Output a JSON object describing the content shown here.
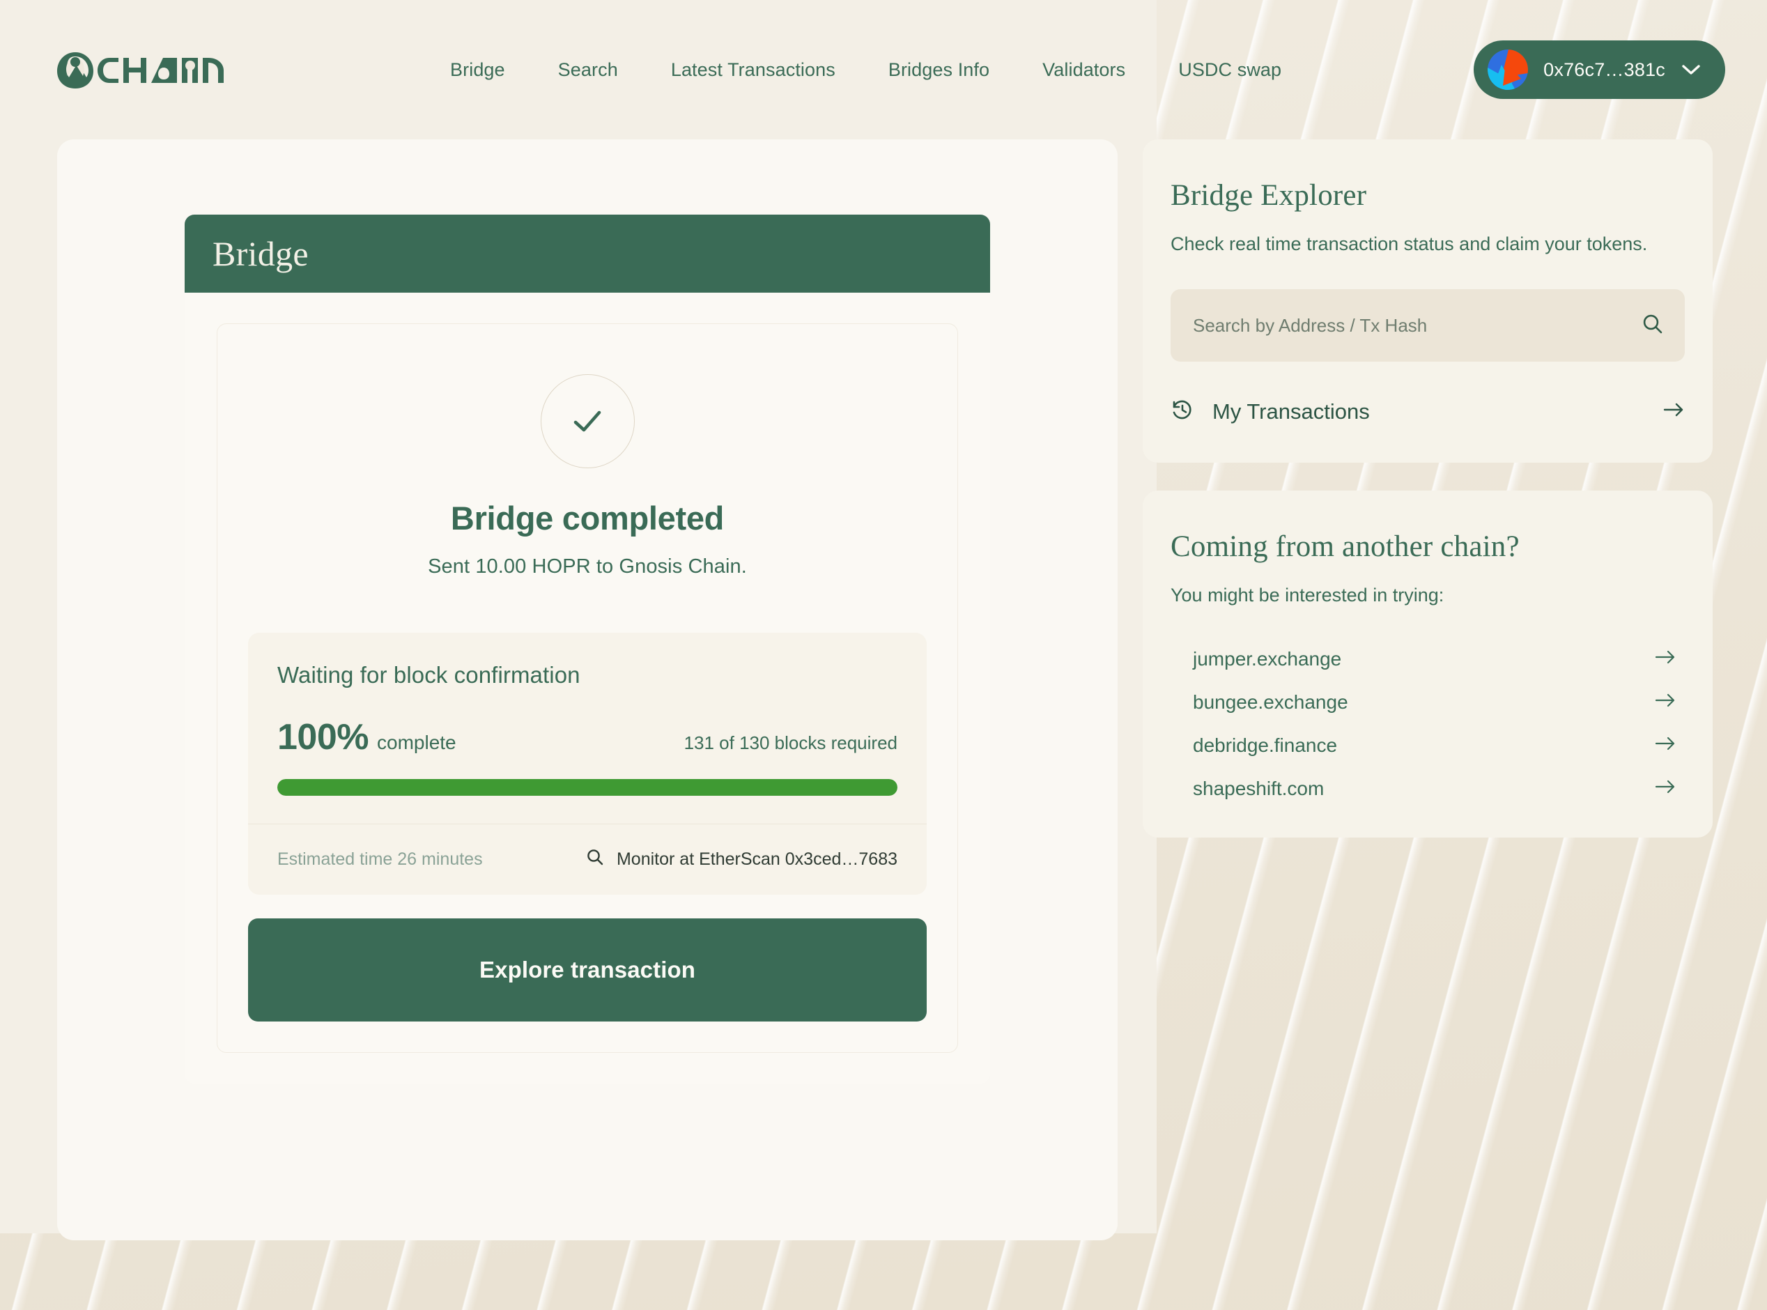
{
  "brand": {
    "logo_text": "CHAIN",
    "logo_icon": "hopr-owl-logo"
  },
  "nav": {
    "links": [
      {
        "label": "Bridge"
      },
      {
        "label": "Search"
      },
      {
        "label": "Latest Transactions"
      },
      {
        "label": "Bridges Info"
      },
      {
        "label": "Validators"
      },
      {
        "label": "USDC swap"
      }
    ],
    "wallet": {
      "address": "0x76c7…381c",
      "avatar_icon": "wallet-avatar",
      "chevron_icon": "chevron-down-icon"
    }
  },
  "bridge": {
    "header_title": "Bridge",
    "status": {
      "check_icon": "check-icon",
      "title": "Bridge completed",
      "subtitle": "Sent 10.00 HOPR to Gnosis Chain."
    },
    "confirmation": {
      "heading": "Waiting for block confirmation",
      "percent_value": "100%",
      "percent_word": "complete",
      "blocks_text": "131 of 130 blocks required",
      "progress_percent": 100,
      "progress_color": "#3f9a33",
      "estimated_time": "Estimated time 26 minutes",
      "monitor_label": "Monitor at EtherScan 0x3ced…7683",
      "monitor_icon": "search-icon"
    },
    "explore_button": "Explore transaction"
  },
  "explorer": {
    "title": "Bridge Explorer",
    "subtitle": "Check real time transaction status and claim your tokens.",
    "search": {
      "placeholder": "Search by Address / Tx Hash",
      "value": "",
      "icon": "search-icon"
    },
    "my_transactions": {
      "label": "My Transactions",
      "leading_icon": "history-icon",
      "trailing_icon": "arrow-right-icon"
    }
  },
  "other_chain": {
    "title": "Coming from another chain?",
    "subtitle": "You might be interested in trying:",
    "links": [
      {
        "label": "jumper.exchange",
        "icon": "arrow-right-icon"
      },
      {
        "label": "bungee.exchange",
        "icon": "arrow-right-icon"
      },
      {
        "label": "debridge.finance",
        "icon": "arrow-right-icon"
      },
      {
        "label": "shapeshift.com",
        "icon": "arrow-right-icon"
      }
    ]
  },
  "colors": {
    "brand_green": "#3a6b56",
    "progress_green": "#3f9a33",
    "page_bg": "#efe9dd",
    "card_bg": "#faf8f3"
  }
}
